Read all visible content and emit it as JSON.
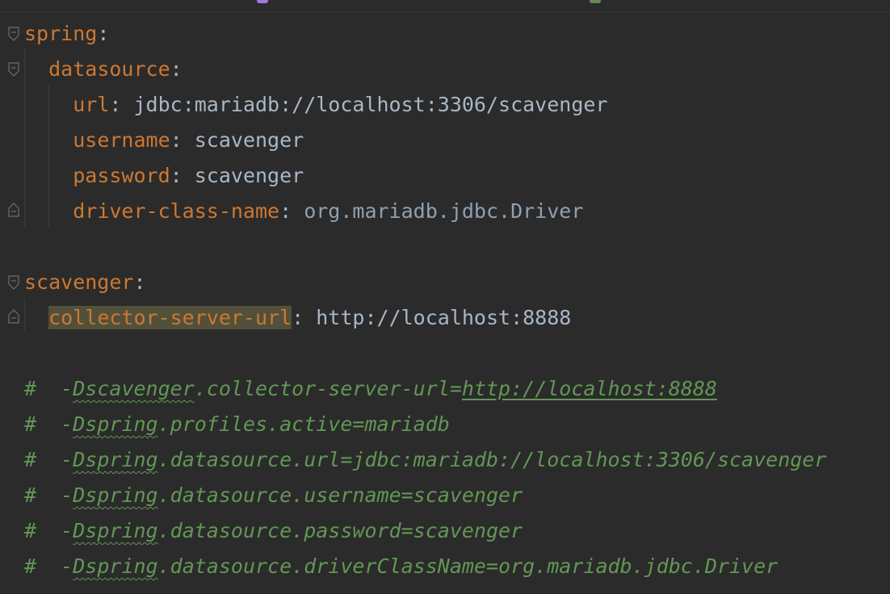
{
  "editor": {
    "language": "YAML",
    "colors": {
      "background": "#2b2b2b",
      "key": "#cc7832",
      "text": "#a9b7c6",
      "class_ref": "#8fa0b1",
      "comment": "#629755",
      "highlight": "#52503a"
    },
    "lines": {
      "spring_key": "spring",
      "datasource_key": "datasource",
      "url_key": "url",
      "url_value": "jdbc:mariadb://localhost:3306/scavenger",
      "username_key": "username",
      "username_value": "scavenger",
      "password_key": "password",
      "password_value": "scavenger",
      "driver_key": "driver-class-name",
      "driver_value": "org.mariadb.jdbc.Driver",
      "scavenger_key": "scavenger",
      "collector_key": "collector-server-url",
      "collector_value": "http://localhost:8888"
    },
    "comments": [
      {
        "hash": "#",
        "prefix": "-",
        "flag": "Dscavenger",
        "rest": ".collector-server-url=",
        "link": "http://localhost:8888"
      },
      {
        "hash": "#",
        "prefix": "-",
        "flag": "Dspring",
        "rest": ".profiles.active=mariadb",
        "link": ""
      },
      {
        "hash": "#",
        "prefix": "-",
        "flag": "Dspring",
        "rest": ".datasource.url=jdbc:mariadb://localhost:3306/scavenger",
        "link": ""
      },
      {
        "hash": "#",
        "prefix": "-",
        "flag": "Dspring",
        "rest": ".datasource.username=scavenger",
        "link": ""
      },
      {
        "hash": "#",
        "prefix": "-",
        "flag": "Dspring",
        "rest": ".datasource.password=scavenger",
        "link": ""
      },
      {
        "hash": "#",
        "prefix": "-",
        "flag": "Dspring",
        "rest": ".datasource.driverClassName=org.mariadb.jdbc.Driver",
        "link": ""
      }
    ]
  }
}
